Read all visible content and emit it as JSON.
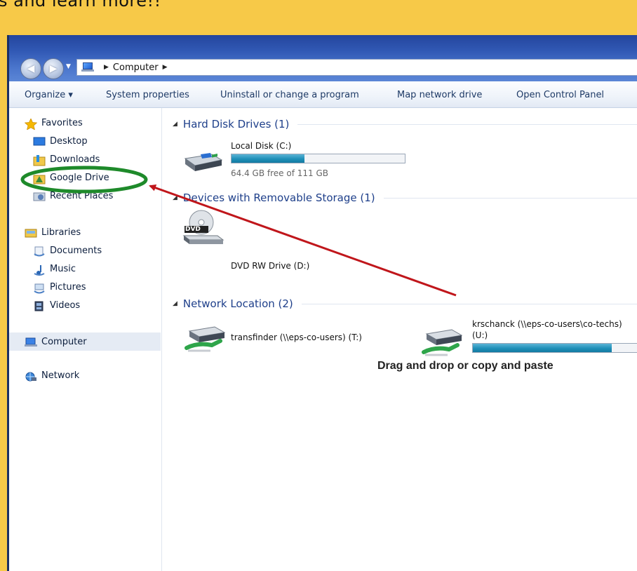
{
  "slide": {
    "caption": "s and learn more!!"
  },
  "window": {
    "address": {
      "segment": "Computer"
    },
    "toolbar": {
      "organize": "Organize ▾",
      "system_properties": "System properties",
      "uninstall": "Uninstall or change a program",
      "map_network_drive": "Map network drive",
      "open_control_panel": "Open Control Panel"
    },
    "sidebar": {
      "favorites": "Favorites",
      "desktop": "Desktop",
      "downloads": "Downloads",
      "google_drive": "Google Drive",
      "recent_places": "Recent Places",
      "libraries": "Libraries",
      "documents": "Documents",
      "music": "Music",
      "pictures": "Pictures",
      "videos": "Videos",
      "computer": "Computer",
      "network": "Network"
    },
    "groups": {
      "hard_disk": "Hard Disk Drives (1)",
      "removable": "Devices with Removable Storage (1)",
      "network": "Network Location (2)"
    },
    "drives": {
      "local_disk": {
        "name": "Local Disk (C:)",
        "free_text": "64.4 GB free of 111 GB",
        "used_fraction": 0.42
      },
      "dvd": {
        "name": "DVD RW Drive (D:)",
        "badge": "DVD"
      },
      "transfinder": {
        "name": "transfinder (\\\\eps-co-users) (T:)"
      },
      "krschanck": {
        "name": "krschanck (\\\\eps-co-users\\co-techs)",
        "letter": "(U:)",
        "used_fraction": 0.82
      }
    },
    "annotation": "Drag and drop or copy and paste"
  },
  "colors": {
    "slide_background": "#f7c948",
    "highlight_ellipse": "#1e8a2a",
    "arrow": "#c0161b",
    "bar_fill": "#1f8fb8"
  }
}
